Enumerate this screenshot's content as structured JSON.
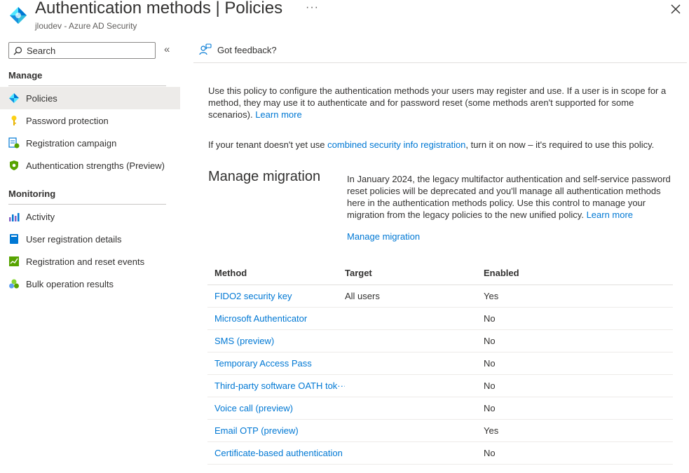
{
  "header": {
    "title": "Authentication methods",
    "separator": " | ",
    "title_suffix": "Policies",
    "subtitle": "jloudev - Azure AD Security",
    "more_label": "···"
  },
  "sidebar": {
    "search": {
      "placeholder": "Search",
      "value": ""
    },
    "collapse_label": "«",
    "sections": [
      {
        "heading": "Manage",
        "items": [
          {
            "label": "Policies",
            "icon": "policies-diamond-icon",
            "active": true
          },
          {
            "label": "Password protection",
            "icon": "key-icon"
          },
          {
            "label": "Registration campaign",
            "icon": "registration-campaign-icon"
          },
          {
            "label": "Authentication strengths (Preview)",
            "icon": "shield-icon"
          }
        ]
      },
      {
        "heading": "Monitoring",
        "items": [
          {
            "label": "Activity",
            "icon": "activity-chart-icon"
          },
          {
            "label": "User registration details",
            "icon": "user-details-icon"
          },
          {
            "label": "Registration and reset events",
            "icon": "events-log-icon"
          },
          {
            "label": "Bulk operation results",
            "icon": "bulk-results-icon"
          }
        ]
      }
    ]
  },
  "toolbar": {
    "feedback_label": "Got feedback?"
  },
  "intro": {
    "text": "Use this policy to configure the authentication methods your users may register and use. If a user is in scope for a method, they may use it to authenticate and for password reset (some methods aren't supported for some scenarios).",
    "learn_more": "Learn more",
    "tenant_prefix": "If your tenant doesn't yet use ",
    "tenant_link": "combined security info registration",
    "tenant_suffix": ", turn it on now – it's required to use this policy."
  },
  "migration": {
    "title": "Manage migration",
    "text": "In January 2024, the legacy multifactor authentication and self-service password reset policies will be deprecated and you'll manage all authentication methods here in the authentication methods policy. Use this control to manage your migration from the legacy policies to the new unified policy.",
    "learn_more": "Learn more",
    "link": "Manage migration"
  },
  "table": {
    "columns": [
      "Method",
      "Target",
      "Enabled"
    ],
    "rows": [
      {
        "method": "FIDO2 security key",
        "target": "All users",
        "enabled": "Yes"
      },
      {
        "method": "Microsoft Authenticator",
        "target": "",
        "enabled": "No"
      },
      {
        "method": "SMS (preview)",
        "target": "",
        "enabled": "No"
      },
      {
        "method": "Temporary Access Pass",
        "target": "",
        "enabled": "No"
      },
      {
        "method": "Third-party software OATH tok···",
        "target": "",
        "enabled": "No"
      },
      {
        "method": "Voice call (preview)",
        "target": "",
        "enabled": "No"
      },
      {
        "method": "Email OTP (preview)",
        "target": "",
        "enabled": "Yes"
      },
      {
        "method": "Certificate-based authentication",
        "target": "",
        "enabled": "No"
      }
    ]
  },
  "colors": {
    "link": "#0078d4",
    "active_bg": "#edebe9",
    "text": "#323130",
    "muted": "#605e5c"
  }
}
